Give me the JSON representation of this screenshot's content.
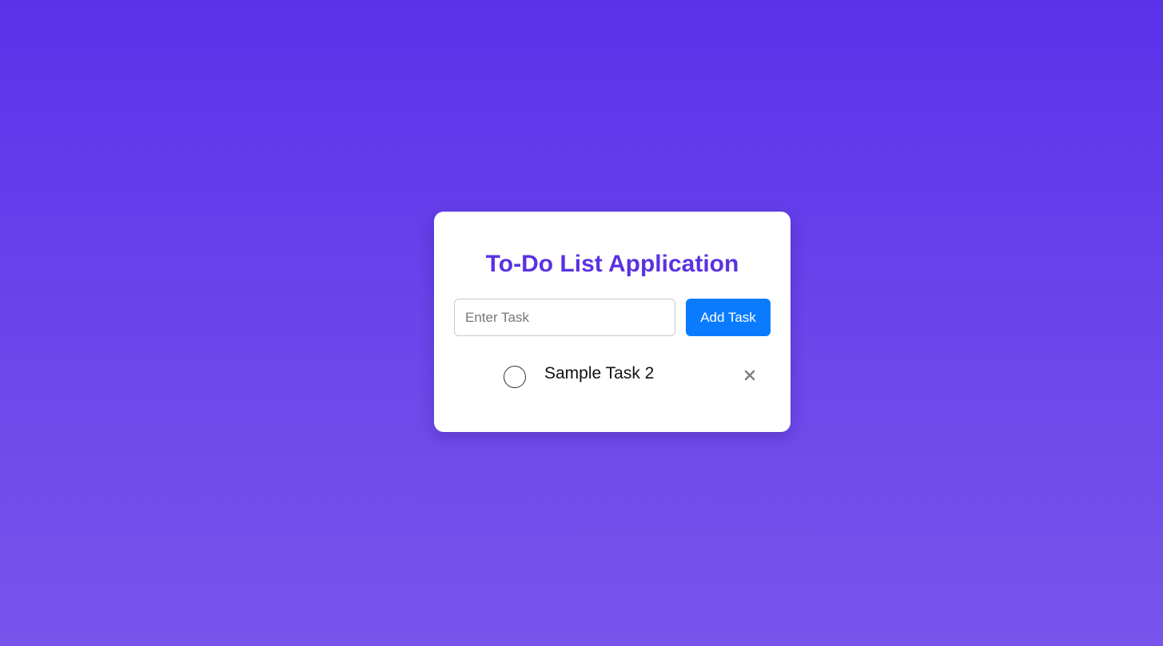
{
  "app": {
    "title": "To-Do List Application"
  },
  "form": {
    "input_value": "",
    "input_placeholder": "Enter Task",
    "add_button_label": "Add Task"
  },
  "tasks": [
    {
      "text": "Sample Task 2",
      "completed": false
    }
  ],
  "icons": {
    "check": "circle-checkbox-icon",
    "delete": "close-icon"
  },
  "colors": {
    "background_top": "#5a32ea",
    "background_bottom": "#7854ed",
    "title": "#5a32e0",
    "button": "#0a7bff",
    "delete_icon": "#808080"
  }
}
